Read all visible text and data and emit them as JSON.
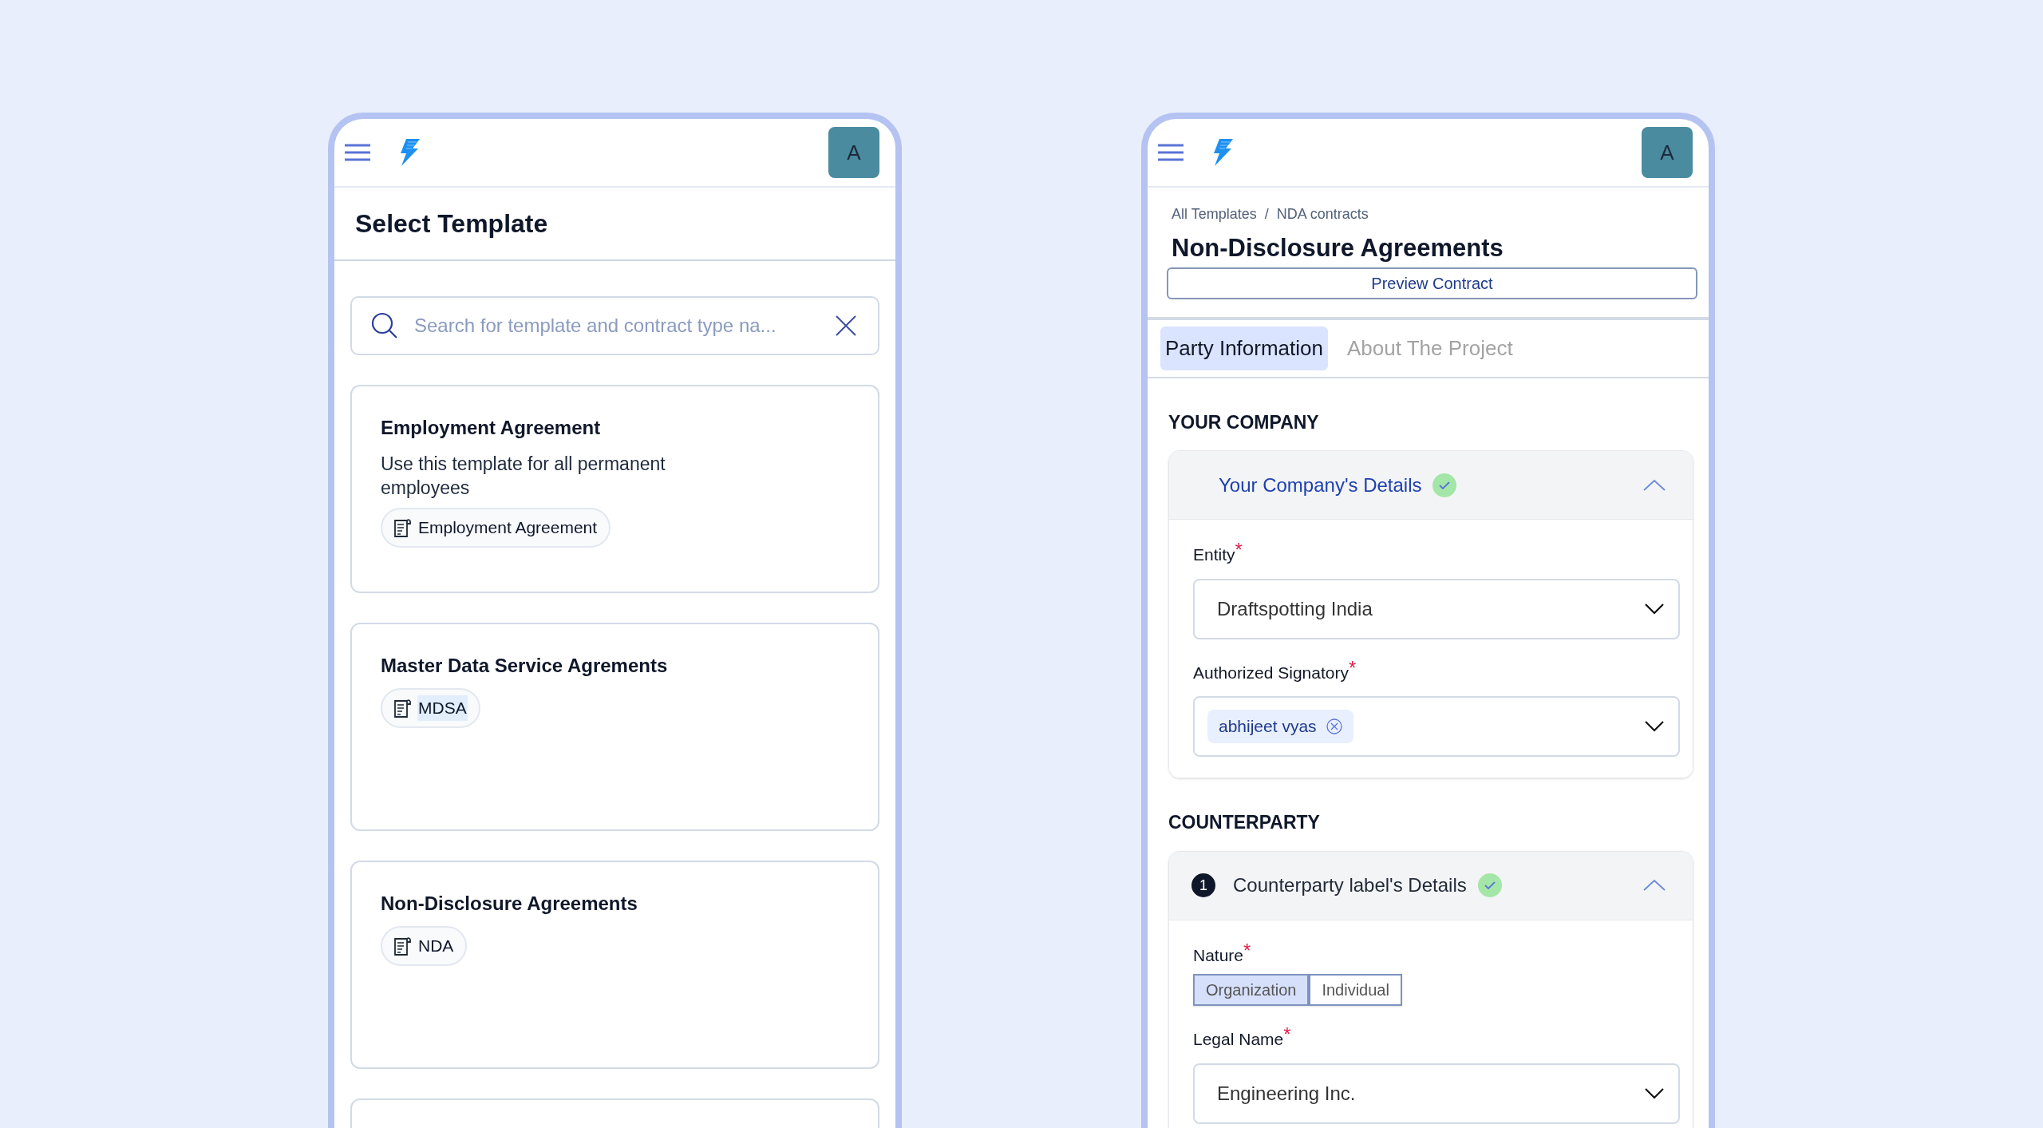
{
  "template_picker": {
    "avatar": "A",
    "title": "Select Template",
    "search": {
      "placeholder": "Search for template and contract type na..."
    },
    "templates": [
      {
        "title": "Employment Agreement",
        "description": "Use this template for all permanent employees",
        "tag": "Employment Agreement",
        "tag_selected": false
      },
      {
        "title": "Master Data Service Agrements",
        "tag": "MDSA",
        "tag_selected": true
      },
      {
        "title": "Non-Disclosure Agreements",
        "tag": "NDA",
        "tag_selected": false
      }
    ]
  },
  "contract_form": {
    "avatar": "A",
    "breadcrumb": {
      "items": [
        "All Templates",
        "NDA contracts"
      ],
      "separator": "/"
    },
    "title": "Non-Disclosure Agreements",
    "preview_button": "Preview Contract",
    "tabs": [
      {
        "label": "Party Information",
        "selected": true
      },
      {
        "label": "About The Project",
        "selected": false
      }
    ],
    "sections": [
      {
        "heading": "YOUR COMPANY",
        "panel": {
          "title": "Your Company's Details",
          "active": true,
          "complete": true,
          "expanded": true,
          "fields": [
            {
              "kind": "select",
              "label": "Entity",
              "required_mark": "*",
              "value": "Draftspotting India"
            },
            {
              "kind": "multiselect",
              "label": "Authorized Signatory",
              "required_mark": "*",
              "chips": [
                "abhijeet vyas"
              ]
            }
          ]
        }
      },
      {
        "heading": "COUNTERPARTY",
        "panel": {
          "number": "1",
          "title": "Counterparty label's Details",
          "active": false,
          "complete": true,
          "expanded": true,
          "fields": [
            {
              "kind": "toggle",
              "label": "Nature",
              "required_mark": "*",
              "options": [
                {
                  "label": "Organization",
                  "selected": true
                },
                {
                  "label": "Individual",
                  "selected": false
                }
              ]
            },
            {
              "kind": "select",
              "label": "Legal Name",
              "required_mark": "*",
              "value": "Engineering Inc."
            }
          ]
        }
      }
    ]
  }
}
